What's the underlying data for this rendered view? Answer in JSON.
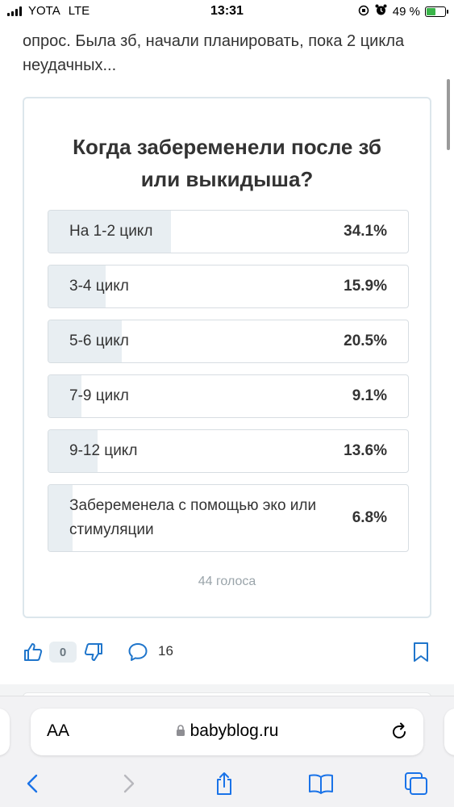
{
  "status_bar": {
    "carrier": "YOTA",
    "network": "LTE",
    "time": "13:31",
    "battery": "49 %",
    "battery_level": 0.49
  },
  "intro_text": "опрос. Была зб, начали планировать, пока 2 цикла неудачных...",
  "poll": {
    "title": "Когда забеременели после зб или выкидыша?",
    "options": [
      {
        "label": "На 1-2 цикл",
        "percent": "34.1%",
        "value": 34.1
      },
      {
        "label": "3-4 цикл",
        "percent": "15.9%",
        "value": 15.9
      },
      {
        "label": "5-6 цикл",
        "percent": "20.5%",
        "value": 20.5
      },
      {
        "label": "7-9 цикл",
        "percent": "9.1%",
        "value": 9.1
      },
      {
        "label": "9-12 цикл",
        "percent": "13.6%",
        "value": 13.6
      },
      {
        "label": "Забеременела с помощью эко или стимуляции",
        "percent": "6.8%",
        "value": 6.8
      }
    ],
    "votes": "44 голоса"
  },
  "actions": {
    "like_count": "0",
    "comment_count": "16"
  },
  "browser": {
    "aa_label": "AA",
    "url": "babyblog.ru"
  },
  "colors": {
    "poll_border": "#dce6ec",
    "bar_fill": "#e8eef2",
    "ios_blue": "#1a73e8"
  }
}
